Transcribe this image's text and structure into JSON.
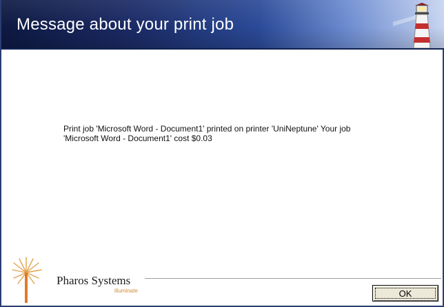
{
  "dialog": {
    "title": "Message about your print job",
    "message_lines": [
      "Print job 'Microsoft Word - Document1' printed on printer 'UniNeptune' Your job",
      "'Microsoft Word - Document1'  cost $0.03"
    ],
    "brand": {
      "name": "Pharos Systems",
      "tagline": "illuminate"
    },
    "ok_label": "OK"
  },
  "colors": {
    "banner_dark": "#0e1942",
    "banner_light": "#c9d6f1",
    "brand_orange": "#d08a3a"
  },
  "icons": {
    "banner": "lighthouse-icon",
    "brand": "pharos-burst-logo-icon"
  }
}
